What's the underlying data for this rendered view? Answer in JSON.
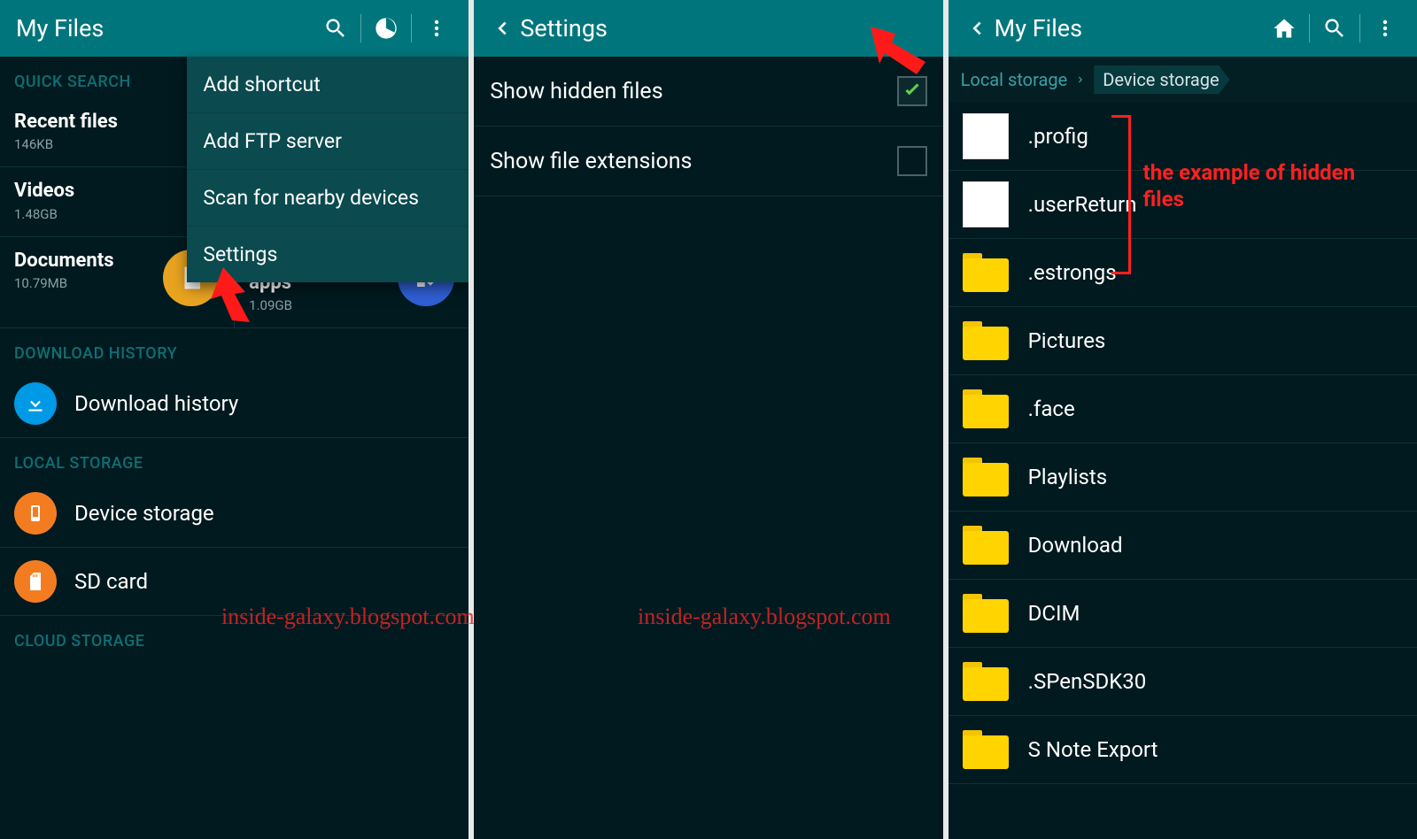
{
  "panel1": {
    "title": "My Files",
    "sections": {
      "quick": "QUICK SEARCH",
      "downloadHistory": "DOWNLOAD HISTORY",
      "localStorage": "LOCAL STORAGE",
      "cloudStorage": "CLOUD STORAGE"
    },
    "tiles": {
      "recent": {
        "title": "Recent files",
        "sub": "146KB"
      },
      "videos": {
        "title": "Videos",
        "sub": "1.48GB"
      },
      "documents": {
        "title": "Documents",
        "sub": "10.79MB"
      },
      "apps": {
        "title": "Downloaded apps",
        "sub": "1.09GB"
      }
    },
    "list": {
      "downloadHistory": "Download history",
      "deviceStorage": "Device storage",
      "sdCard": "SD card"
    },
    "menu": [
      "Add shortcut",
      "Add FTP server",
      "Scan for nearby devices",
      "Settings"
    ]
  },
  "panel2": {
    "title": "Settings",
    "rows": {
      "hidden": {
        "label": "Show hidden files",
        "checked": true
      },
      "ext": {
        "label": "Show file extensions",
        "checked": false
      }
    }
  },
  "panel3": {
    "title": "My Files",
    "breadcrumb": {
      "root": "Local storage",
      "current": "Device storage"
    },
    "files": [
      {
        "name": ".profig",
        "icon": "doc"
      },
      {
        "name": ".userReturn",
        "icon": "doc"
      },
      {
        "name": ".estrongs",
        "icon": "folder"
      },
      {
        "name": "Pictures",
        "icon": "folder"
      },
      {
        "name": ".face",
        "icon": "folder"
      },
      {
        "name": "Playlists",
        "icon": "folder"
      },
      {
        "name": "Download",
        "icon": "folder"
      },
      {
        "name": "DCIM",
        "icon": "folder"
      },
      {
        "name": ".SPenSDK30",
        "icon": "folder"
      },
      {
        "name": "S Note Export",
        "icon": "folder"
      }
    ]
  },
  "annotations": {
    "hiddenExample": "the example of hidden files",
    "watermark": "inside-galaxy.blogspot.com"
  }
}
